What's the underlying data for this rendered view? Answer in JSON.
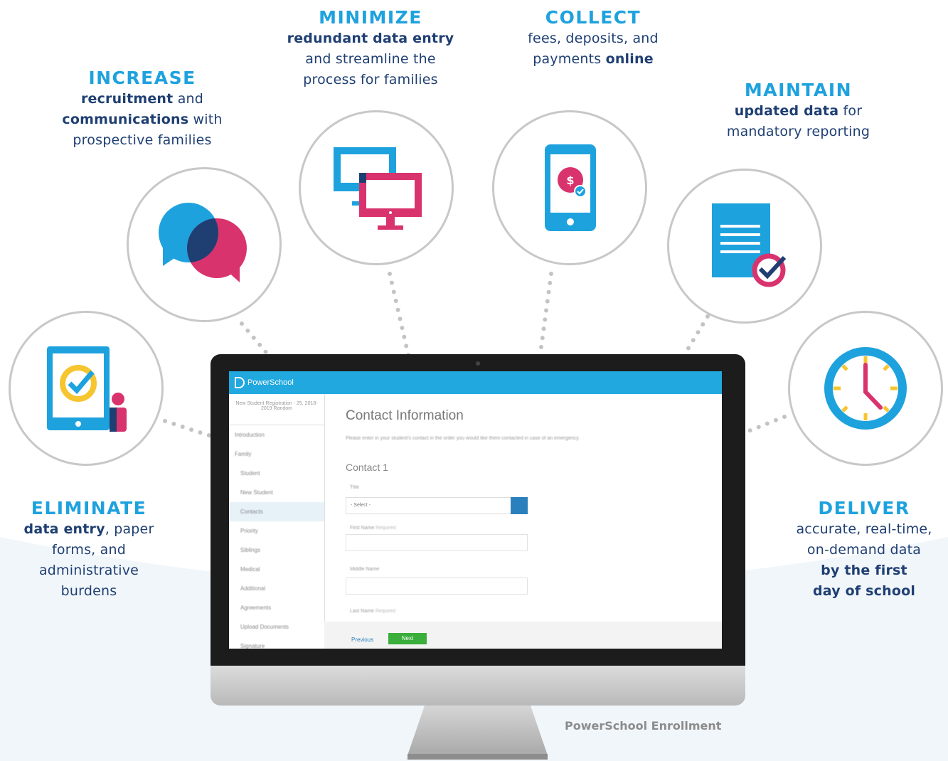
{
  "colors": {
    "accent_blue": "#1ea2de",
    "navy": "#1f3f73",
    "magenta": "#d9336e",
    "yellow": "#f6c52f",
    "green": "#3aae3a"
  },
  "benefits": {
    "increase": {
      "icon": "speech-bubbles-icon",
      "heading": "INCREASE",
      "b1": "recruitment",
      "t1": " and",
      "b2": "communications",
      "t2": " with",
      "t3": "prospective families"
    },
    "minimize": {
      "icon": "dual-monitors-icon",
      "heading": "MINIMIZE",
      "b1": "redundant data entry",
      "t1": "and streamline the",
      "t2": "process for families"
    },
    "collect": {
      "icon": "mobile-payment-icon",
      "heading": "COLLECT",
      "t1": "fees, deposits, and",
      "t2": "payments ",
      "b1": "online"
    },
    "maintain": {
      "icon": "checked-document-icon",
      "heading": "MAINTAIN",
      "b1": "updated data",
      "t1": " for",
      "t2": "mandatory reporting"
    },
    "eliminate": {
      "icon": "tablet-check-icon",
      "heading": "ELIMINATE",
      "b1": "data entry",
      "t1": ", paper",
      "t2": "forms, and",
      "t3": "administrative",
      "t4": "burdens"
    },
    "deliver": {
      "icon": "clock-icon",
      "heading": "DELIVER",
      "t1": "accurate, real-time,",
      "t2": "on-demand data",
      "b1": "by the first",
      "b2": "day of school"
    }
  },
  "screen": {
    "brand": "PowerSchool",
    "sidebar_header": "New Student Registration - 25, 2018-2019 Random",
    "sidebar_items": [
      "Introduction",
      "Family",
      "Student",
      "New Student",
      "Contacts",
      "Priority",
      "Siblings",
      "Medical",
      "Additional",
      "Agreements",
      "Upload Documents",
      "Signature"
    ],
    "title": "Contact Information",
    "description": "Please enter in your student's contact in the order you would like them contacted in case of an emergency.",
    "subtitle": "Contact 1",
    "field_title": "Title",
    "select_value": "- Select -",
    "field_first": "First Name",
    "field_first_hint": "Required",
    "field_middle": "Middle Name",
    "field_last": "Last Name",
    "field_last_hint": "Required",
    "prev": "Previous",
    "next": "Next"
  },
  "footer_brand": "PowerSchool Enrollment"
}
